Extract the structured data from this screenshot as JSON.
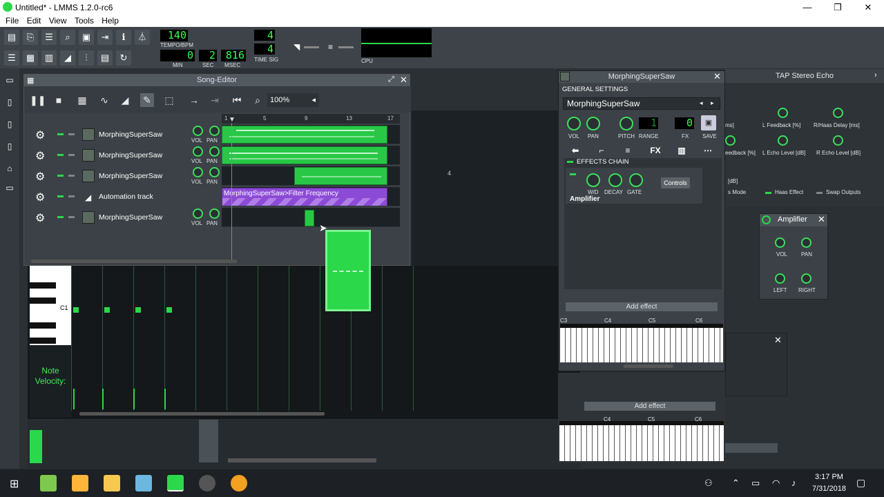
{
  "window": {
    "title": "Untitled* - LMMS 1.2.0-rc6",
    "minimize": "—",
    "maximize": "❐",
    "close": "✕"
  },
  "menu": [
    "File",
    "Edit",
    "View",
    "Tools",
    "Help"
  ],
  "transport": {
    "tempo": "140",
    "tempo_label": "TEMPO/BPM",
    "min": "0",
    "sec": "2",
    "msec": "816",
    "min_label": "MIN",
    "sec_label": "SEC",
    "msec_label": "MSEC",
    "ts_num": "4",
    "ts_den": "4",
    "ts_label": "TIME SIG",
    "cpu_label": "CPU"
  },
  "song_editor": {
    "title": "Song-Editor",
    "zoom": "100%",
    "bar_labels": [
      "1",
      "5",
      "9",
      "13",
      "17"
    ],
    "tracks": [
      {
        "name": "MorphingSuperSaw",
        "vol": "VOL",
        "pan": "PAN"
      },
      {
        "name": "MorphingSuperSaw",
        "vol": "VOL",
        "pan": "PAN"
      },
      {
        "name": "MorphingSuperSaw",
        "vol": "VOL",
        "pan": "PAN"
      },
      {
        "name": "Automation track"
      },
      {
        "name": "MorphingSuperSaw",
        "vol": "VOL",
        "pan": "PAN"
      }
    ],
    "automation_clip": "MorphingSuperSaw>Filter Frequency"
  },
  "piano_roll": {
    "key_label": "C1",
    "velocity_label": "Note\nVelocity:",
    "bar_label": "4"
  },
  "instrument": {
    "title": "MorphingSuperSaw",
    "general_settings": "GENERAL SETTINGS",
    "name": "MorphingSuperSaw",
    "knobs": [
      "VOL",
      "PAN",
      "PITCH",
      "RANGE",
      "FX",
      "SAVE"
    ],
    "pitch_range": "1",
    "fx_channel": "0",
    "tab_fx": "FX",
    "effects_chain": "EFFECTS CHAIN",
    "effect_knobs": [
      "W/D",
      "DECAY",
      "GATE"
    ],
    "controls": "Controls",
    "effect_name": "Amplifier",
    "add_effect": "Add effect",
    "octaves": [
      "C3",
      "C4",
      "C5",
      "C6"
    ]
  },
  "tap_echo": {
    "title": "TAP Stereo Echo",
    "labels": [
      "ms]",
      "L Feedback [%]",
      "R/Haas Delay [ms]",
      "eedback [%]",
      "L Echo Level [dB]",
      "R Echo Level [dB]",
      "[dB]",
      "s Mode",
      "Haas Effect",
      "Swap Outputs"
    ]
  },
  "amplifier": {
    "title": "Amplifier",
    "knobs": [
      "VOL",
      "PAN",
      "LEFT",
      "RIGHT"
    ]
  },
  "second_add_effect": "Add effect",
  "taskbar": {
    "time": "3:17 PM",
    "date": "7/31/2018"
  }
}
